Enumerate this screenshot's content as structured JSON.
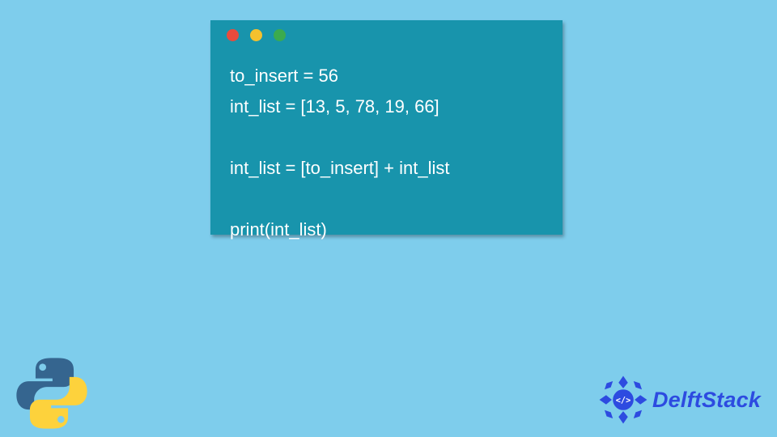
{
  "window": {
    "dots": [
      "red",
      "yellow",
      "green"
    ]
  },
  "code": {
    "lines": [
      "to_insert = 56",
      "int_list = [13, 5, 78, 19, 66]",
      "",
      "int_list = [to_insert] + int_list",
      "",
      "print(int_list)"
    ]
  },
  "branding": {
    "python_icon": "python-logo",
    "delft_icon": "delftstack-badge",
    "delft_label": "DelftStack"
  }
}
